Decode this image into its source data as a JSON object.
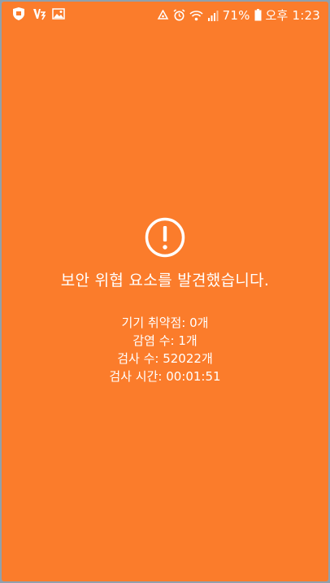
{
  "status_bar": {
    "battery": "71%",
    "time": "오후 1:23",
    "left_icons": [
      "app-shield-icon",
      "v3-icon",
      "image-icon"
    ],
    "right_icons": [
      "recycle-icon",
      "alarm-icon",
      "wifi-icon",
      "signal-icon",
      "battery-icon"
    ]
  },
  "result": {
    "headline": "보안 위협 요소를 발견했습니다.",
    "stats": [
      "기기 취약점: 0개",
      "감염 수: 1개",
      "검사 수: 52022개",
      "검사 시간: 00:01:51"
    ]
  },
  "colors": {
    "background": "#fb7c2b",
    "text": "#ffffff"
  }
}
